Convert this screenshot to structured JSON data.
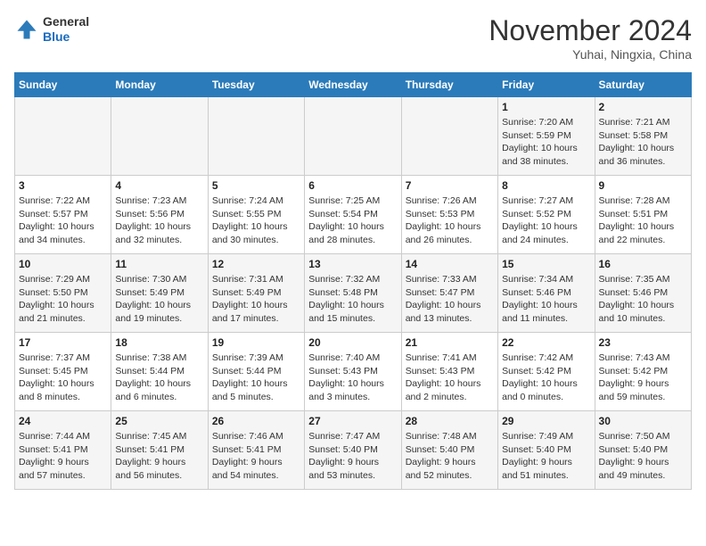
{
  "header": {
    "logo_line1": "General",
    "logo_line2": "Blue",
    "month_title": "November 2024",
    "location": "Yuhai, Ningxia, China"
  },
  "days_of_week": [
    "Sunday",
    "Monday",
    "Tuesday",
    "Wednesday",
    "Thursday",
    "Friday",
    "Saturday"
  ],
  "weeks": [
    [
      {
        "day": "",
        "info": ""
      },
      {
        "day": "",
        "info": ""
      },
      {
        "day": "",
        "info": ""
      },
      {
        "day": "",
        "info": ""
      },
      {
        "day": "",
        "info": ""
      },
      {
        "day": "1",
        "info": "Sunrise: 7:20 AM\nSunset: 5:59 PM\nDaylight: 10 hours\nand 38 minutes."
      },
      {
        "day": "2",
        "info": "Sunrise: 7:21 AM\nSunset: 5:58 PM\nDaylight: 10 hours\nand 36 minutes."
      }
    ],
    [
      {
        "day": "3",
        "info": "Sunrise: 7:22 AM\nSunset: 5:57 PM\nDaylight: 10 hours\nand 34 minutes."
      },
      {
        "day": "4",
        "info": "Sunrise: 7:23 AM\nSunset: 5:56 PM\nDaylight: 10 hours\nand 32 minutes."
      },
      {
        "day": "5",
        "info": "Sunrise: 7:24 AM\nSunset: 5:55 PM\nDaylight: 10 hours\nand 30 minutes."
      },
      {
        "day": "6",
        "info": "Sunrise: 7:25 AM\nSunset: 5:54 PM\nDaylight: 10 hours\nand 28 minutes."
      },
      {
        "day": "7",
        "info": "Sunrise: 7:26 AM\nSunset: 5:53 PM\nDaylight: 10 hours\nand 26 minutes."
      },
      {
        "day": "8",
        "info": "Sunrise: 7:27 AM\nSunset: 5:52 PM\nDaylight: 10 hours\nand 24 minutes."
      },
      {
        "day": "9",
        "info": "Sunrise: 7:28 AM\nSunset: 5:51 PM\nDaylight: 10 hours\nand 22 minutes."
      }
    ],
    [
      {
        "day": "10",
        "info": "Sunrise: 7:29 AM\nSunset: 5:50 PM\nDaylight: 10 hours\nand 21 minutes."
      },
      {
        "day": "11",
        "info": "Sunrise: 7:30 AM\nSunset: 5:49 PM\nDaylight: 10 hours\nand 19 minutes."
      },
      {
        "day": "12",
        "info": "Sunrise: 7:31 AM\nSunset: 5:49 PM\nDaylight: 10 hours\nand 17 minutes."
      },
      {
        "day": "13",
        "info": "Sunrise: 7:32 AM\nSunset: 5:48 PM\nDaylight: 10 hours\nand 15 minutes."
      },
      {
        "day": "14",
        "info": "Sunrise: 7:33 AM\nSunset: 5:47 PM\nDaylight: 10 hours\nand 13 minutes."
      },
      {
        "day": "15",
        "info": "Sunrise: 7:34 AM\nSunset: 5:46 PM\nDaylight: 10 hours\nand 11 minutes."
      },
      {
        "day": "16",
        "info": "Sunrise: 7:35 AM\nSunset: 5:46 PM\nDaylight: 10 hours\nand 10 minutes."
      }
    ],
    [
      {
        "day": "17",
        "info": "Sunrise: 7:37 AM\nSunset: 5:45 PM\nDaylight: 10 hours\nand 8 minutes."
      },
      {
        "day": "18",
        "info": "Sunrise: 7:38 AM\nSunset: 5:44 PM\nDaylight: 10 hours\nand 6 minutes."
      },
      {
        "day": "19",
        "info": "Sunrise: 7:39 AM\nSunset: 5:44 PM\nDaylight: 10 hours\nand 5 minutes."
      },
      {
        "day": "20",
        "info": "Sunrise: 7:40 AM\nSunset: 5:43 PM\nDaylight: 10 hours\nand 3 minutes."
      },
      {
        "day": "21",
        "info": "Sunrise: 7:41 AM\nSunset: 5:43 PM\nDaylight: 10 hours\nand 2 minutes."
      },
      {
        "day": "22",
        "info": "Sunrise: 7:42 AM\nSunset: 5:42 PM\nDaylight: 10 hours\nand 0 minutes."
      },
      {
        "day": "23",
        "info": "Sunrise: 7:43 AM\nSunset: 5:42 PM\nDaylight: 9 hours\nand 59 minutes."
      }
    ],
    [
      {
        "day": "24",
        "info": "Sunrise: 7:44 AM\nSunset: 5:41 PM\nDaylight: 9 hours\nand 57 minutes."
      },
      {
        "day": "25",
        "info": "Sunrise: 7:45 AM\nSunset: 5:41 PM\nDaylight: 9 hours\nand 56 minutes."
      },
      {
        "day": "26",
        "info": "Sunrise: 7:46 AM\nSunset: 5:41 PM\nDaylight: 9 hours\nand 54 minutes."
      },
      {
        "day": "27",
        "info": "Sunrise: 7:47 AM\nSunset: 5:40 PM\nDaylight: 9 hours\nand 53 minutes."
      },
      {
        "day": "28",
        "info": "Sunrise: 7:48 AM\nSunset: 5:40 PM\nDaylight: 9 hours\nand 52 minutes."
      },
      {
        "day": "29",
        "info": "Sunrise: 7:49 AM\nSunset: 5:40 PM\nDaylight: 9 hours\nand 51 minutes."
      },
      {
        "day": "30",
        "info": "Sunrise: 7:50 AM\nSunset: 5:40 PM\nDaylight: 9 hours\nand 49 minutes."
      }
    ]
  ]
}
